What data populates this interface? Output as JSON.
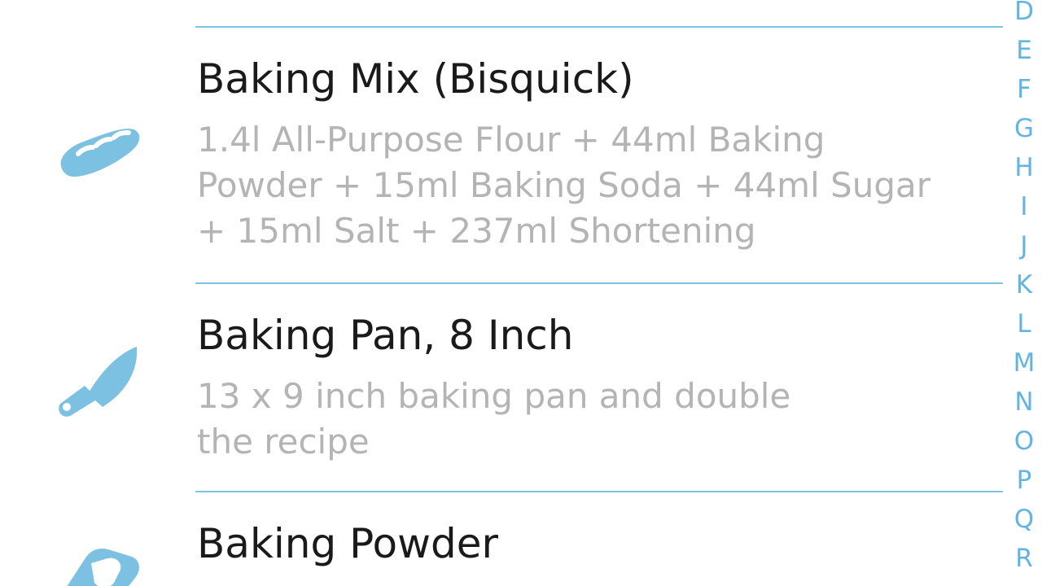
{
  "index_letters": [
    "D",
    "E",
    "F",
    "G",
    "H",
    "I",
    "J",
    "K",
    "L",
    "M",
    "N",
    "O",
    "P",
    "Q",
    "R"
  ],
  "items": [
    {
      "title": "Baking Mix (Bisquick)",
      "lines": [
        "1.4l All-Purpose Flour + 44ml Baking",
        "Powder + 15ml Baking Soda + 44ml Sugar",
        "+ 15ml Salt + 237ml Shortening"
      ],
      "icon": "bread-icon"
    },
    {
      "title": "Baking Pan, 8 Inch",
      "lines": [
        "13 x 9 inch baking pan and double",
        "the recipe"
      ],
      "icon": "spatula-icon"
    },
    {
      "title": "Baking Powder",
      "lines": [],
      "icon": "baking-powder-icon"
    }
  ],
  "colors": {
    "accent": "#62b5e0",
    "icon": "#7cc0e2",
    "divider": "#7cc4e3",
    "title": "#1a1a1a",
    "subtitle": "#b4b4b4"
  }
}
